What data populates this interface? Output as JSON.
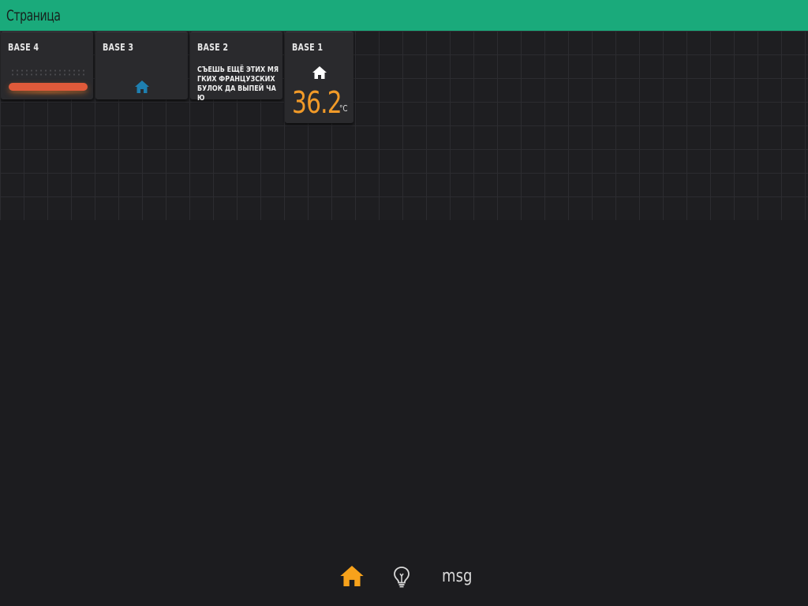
{
  "header": {
    "title": "Страница",
    "bg_color": "#1aaa7b"
  },
  "tiles": [
    {
      "id": "base4",
      "title": "BASE 4",
      "slider_color": "#e05a3a"
    },
    {
      "id": "base3",
      "title": "BASE 3",
      "icon": "home-icon",
      "icon_color": "#1e7fb0"
    },
    {
      "id": "base2",
      "title": "BASE 2",
      "text": "СЪЕШЬ ЕЩЁ ЭТИХ МЯГКИХ ФРАНЦУЗСКИХ БУЛОК ДА ВЫПЕЙ ЧАЮ"
    },
    {
      "id": "base1",
      "title": "BASE 1",
      "icon": "home-icon",
      "value": "36.2",
      "unit": "°C",
      "value_color": "#f19a28"
    }
  ],
  "nav": {
    "items": [
      {
        "name": "home",
        "icon": "home-icon",
        "active": true,
        "color": "#f7a21b"
      },
      {
        "name": "idea",
        "icon": "lightbulb-icon",
        "active": false,
        "color": "#d8d8d8"
      },
      {
        "name": "msg",
        "label": "msg",
        "active": false
      }
    ]
  }
}
